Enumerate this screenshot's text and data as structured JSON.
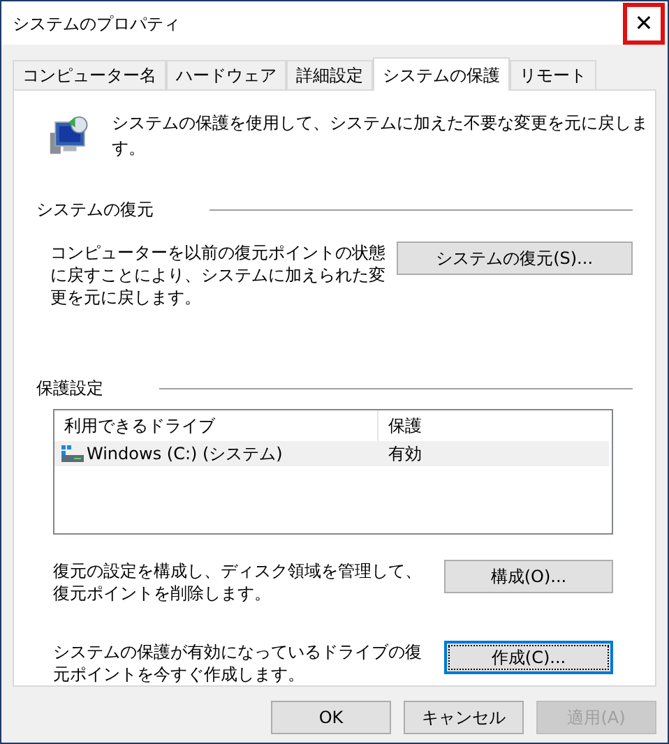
{
  "window": {
    "title": "システムのプロパティ",
    "close": {
      "label": "✕",
      "highlighted": true
    }
  },
  "tabs": [
    {
      "label": "コンピューター名",
      "selected": false
    },
    {
      "label": "ハードウェア",
      "selected": false
    },
    {
      "label": "詳細設定",
      "selected": false
    },
    {
      "label": "システムの保護",
      "selected": true
    },
    {
      "label": "リモート",
      "selected": false
    }
  ],
  "intro": "システムの保護を使用して、システムに加えた不要な変更を元に戻します。",
  "restore": {
    "heading": "システムの復元",
    "description": "コンピューターを以前の復元ポイントの状態に戻すことにより、システムに加えられた変更を元に戻します。",
    "button": "システムの復元(S)..."
  },
  "protection": {
    "heading": "保護設定",
    "table": {
      "columns": [
        "利用できるドライブ",
        "保護"
      ],
      "rows": [
        {
          "drive": "Windows (C:) (システム)",
          "protection": "有効",
          "selected": true
        }
      ]
    },
    "actions": [
      {
        "description": "復元の設定を構成し、ディスク領域を管理して、復元ポイントを削除します。",
        "button": "構成(O)...",
        "focused": false
      },
      {
        "description": "システムの保護が有効になっているドライブの復元ポイントを今すぐ作成します。",
        "button": "作成(C)...",
        "focused": true
      }
    ]
  },
  "buttons": [
    {
      "label": "OK",
      "disabled": false
    },
    {
      "label": "キャンセル",
      "disabled": false
    },
    {
      "label": "適用(A)",
      "disabled": true
    }
  ]
}
